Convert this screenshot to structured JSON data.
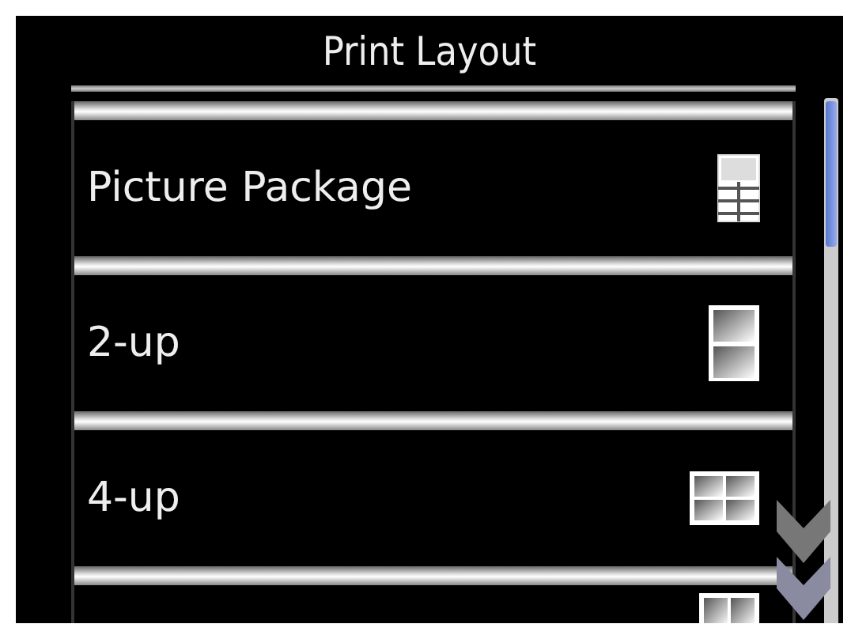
{
  "screen": {
    "title": "Print Layout"
  },
  "items": [
    {
      "label": "Picture Package",
      "kind": "package"
    },
    {
      "label": "2-up",
      "kind": "two"
    },
    {
      "label": "4-up",
      "kind": "four"
    },
    {
      "kind": "wide"
    }
  ]
}
